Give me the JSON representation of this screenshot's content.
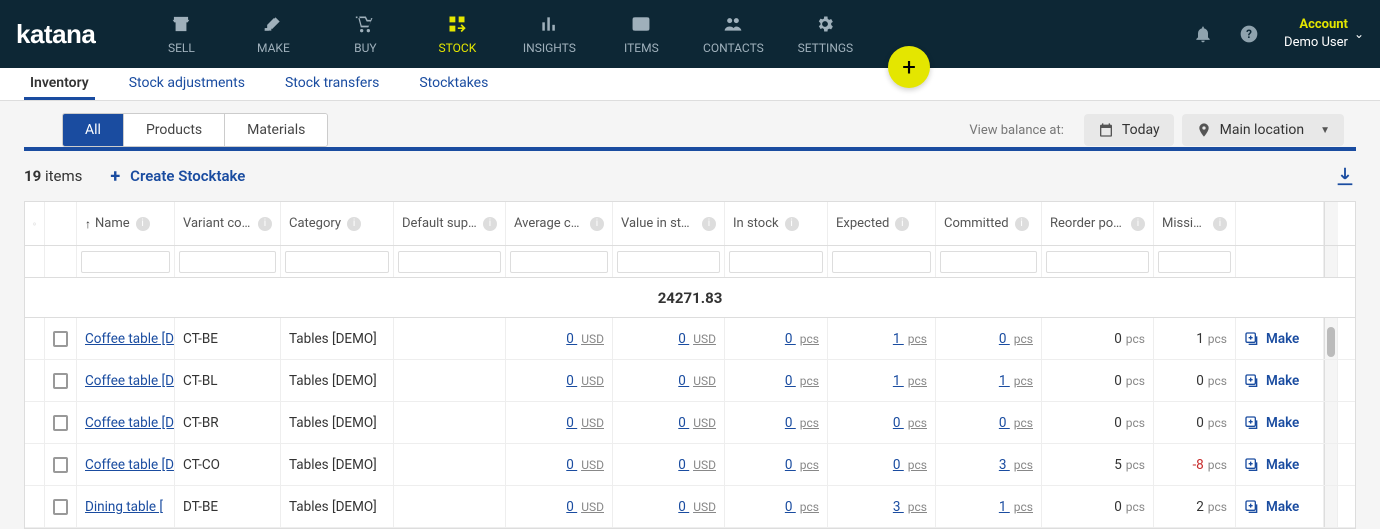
{
  "brand": "katana",
  "nav": [
    {
      "label": "SELL"
    },
    {
      "label": "MAKE"
    },
    {
      "label": "BUY"
    },
    {
      "label": "STOCK"
    },
    {
      "label": "INSIGHTS"
    },
    {
      "label": "ITEMS"
    },
    {
      "label": "CONTACTS"
    },
    {
      "label": "SETTINGS"
    }
  ],
  "nav_active": 3,
  "account": {
    "title": "Account",
    "user": "Demo User"
  },
  "fab": "+",
  "subtabs": [
    "Inventory",
    "Stock adjustments",
    "Stock transfers",
    "Stocktakes"
  ],
  "subtab_active": 0,
  "viewtabs": [
    "All",
    "Products",
    "Materials"
  ],
  "viewtab_active": 0,
  "balance_label": "View balance at:",
  "chip_date": "Today",
  "chip_location": "Main location",
  "count": "19",
  "count_label": "items",
  "create_label": "Create Stocktake",
  "sum_total": "24271.83",
  "columns": {
    "name": "Name",
    "variant": "Variant cod…",
    "category": "Category",
    "supplier": "Default supp…",
    "avg": "Average cost",
    "valstock": "Value in sto…",
    "instock": "In stock",
    "expected": "Expected",
    "committed": "Committed",
    "reorder": "Reorder point",
    "missing": "Missin…",
    "make": "Make"
  },
  "rows": [
    {
      "name": "Coffee table [D",
      "variant": "CT-BE",
      "cat": "Tables [DEMO]",
      "avg": "0",
      "avgU": "USD",
      "val": "0",
      "valU": "USD",
      "instock": "0",
      "instockU": "pcs",
      "instockLnk": true,
      "exp": "1",
      "expU": "pcs",
      "expLnk": true,
      "comm": "0",
      "commU": "pcs",
      "commLnk": true,
      "re": "0",
      "reU": "pcs",
      "miss": "1",
      "missU": "pcs",
      "missNeg": false
    },
    {
      "name": "Coffee table [D",
      "variant": "CT-BL",
      "cat": "Tables [DEMO]",
      "avg": "0",
      "avgU": "USD",
      "val": "0",
      "valU": "USD",
      "instock": "0",
      "instockU": "pcs",
      "instockLnk": true,
      "exp": "1",
      "expU": "pcs",
      "expLnk": true,
      "comm": "1",
      "commU": "pcs",
      "commLnk": true,
      "re": "0",
      "reU": "pcs",
      "miss": "0",
      "missU": "pcs",
      "missNeg": false
    },
    {
      "name": "Coffee table [D",
      "variant": "CT-BR",
      "cat": "Tables [DEMO]",
      "avg": "0",
      "avgU": "USD",
      "val": "0",
      "valU": "USD",
      "instock": "0",
      "instockU": "pcs",
      "instockLnk": true,
      "exp": "0",
      "expU": "pcs",
      "expLnk": true,
      "comm": "0",
      "commU": "pcs",
      "commLnk": true,
      "re": "0",
      "reU": "pcs",
      "miss": "0",
      "missU": "pcs",
      "missNeg": false
    },
    {
      "name": "Coffee table [D",
      "variant": "CT-CO",
      "cat": "Tables [DEMO]",
      "avg": "0",
      "avgU": "USD",
      "val": "0",
      "valU": "USD",
      "instock": "0",
      "instockU": "pcs",
      "instockLnk": true,
      "exp": "0",
      "expU": "pcs",
      "expLnk": true,
      "comm": "3",
      "commU": "pcs",
      "commLnk": true,
      "re": "5",
      "reU": "pcs",
      "miss": "-8",
      "missU": "pcs",
      "missNeg": true
    },
    {
      "name": "Dining table [",
      "variant": "DT-BE",
      "cat": "Tables [DEMO]",
      "avg": "0",
      "avgU": "USD",
      "val": "0",
      "valU": "USD",
      "instock": "0",
      "instockU": "pcs",
      "instockLnk": true,
      "exp": "3",
      "expU": "pcs",
      "expLnk": true,
      "comm": "1",
      "commU": "pcs",
      "commLnk": true,
      "re": "0",
      "reU": "pcs",
      "miss": "2",
      "missU": "pcs",
      "missNeg": false
    }
  ]
}
